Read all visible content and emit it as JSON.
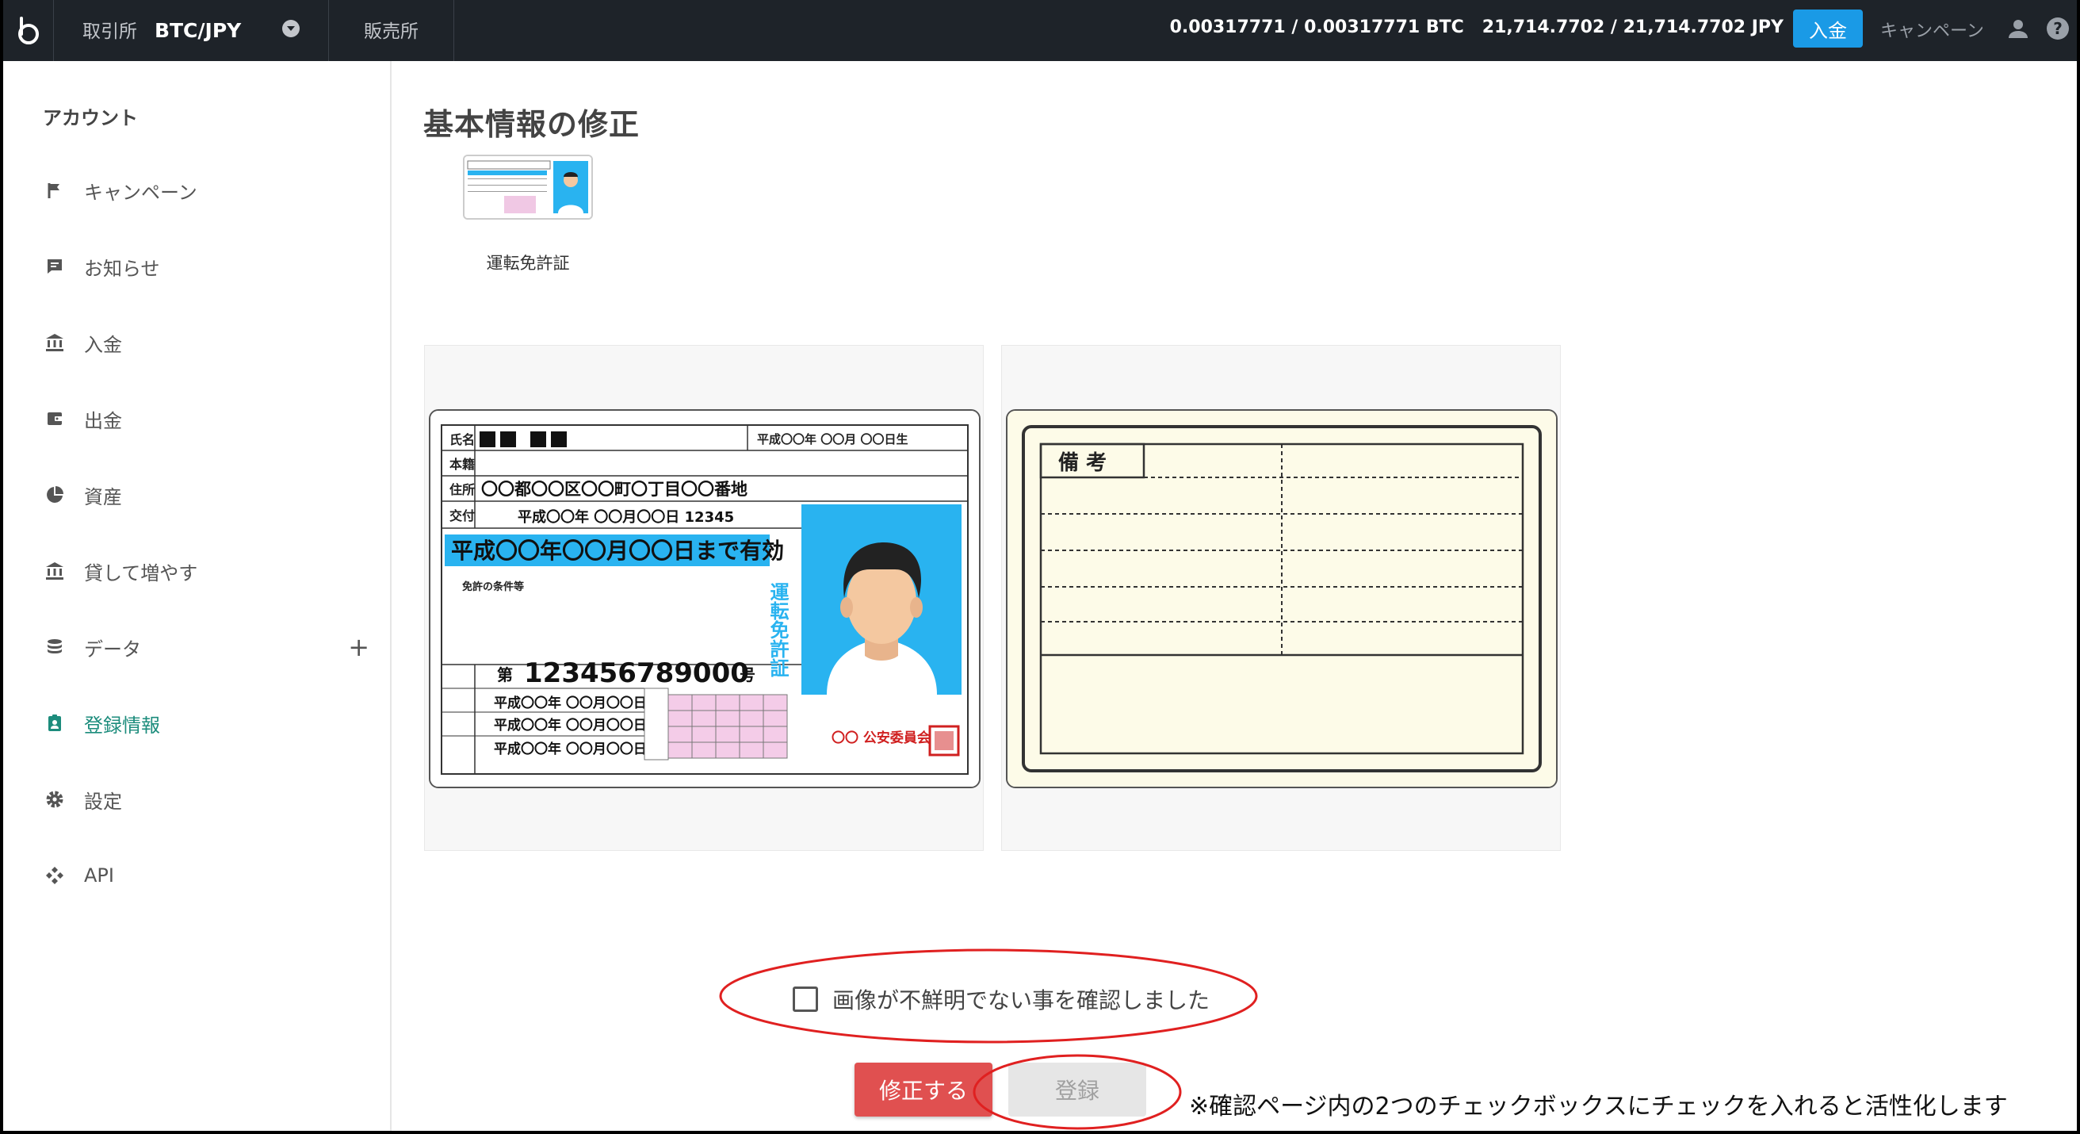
{
  "topbar": {
    "exchange_label": "取引所",
    "pair": "BTC/JPY",
    "sales_label": "販売所",
    "btc_balance": "0.00317771 / 0.00317771 BTC",
    "jpy_balance": "21,714.7702 / 21,714.7702 JPY",
    "deposit_button": "入金",
    "campaign_link": "キャンペーン",
    "icons": [
      "bitbank-logo",
      "chevron-down-icon",
      "user-icon",
      "help-icon"
    ]
  },
  "sidebar": {
    "title": "アカウント",
    "items": [
      {
        "label": "キャンペーン",
        "icon": "flag-icon"
      },
      {
        "label": "お知らせ",
        "icon": "message-icon"
      },
      {
        "label": "入金",
        "icon": "bank-icon"
      },
      {
        "label": "出金",
        "icon": "wallet-icon"
      },
      {
        "label": "資産",
        "icon": "pie-chart-icon"
      },
      {
        "label": "貸して増やす",
        "icon": "bank-icon"
      },
      {
        "label": "データ",
        "icon": "database-icon"
      },
      {
        "label": "登録情報",
        "icon": "id-badge-icon",
        "active": true
      },
      {
        "label": "設定",
        "icon": "gear-icon"
      },
      {
        "label": "API",
        "icon": "api-icon"
      }
    ],
    "active_color": "#1c8c7c"
  },
  "main": {
    "title": "基本情報の修正",
    "doc_type_label": "運転免許証",
    "license_front": {
      "name_label": "氏名",
      "birth": "平成〇〇年 〇〇月 〇〇日生",
      "domicile_label": "本籍",
      "address_label": "住所",
      "address": "〇〇都〇〇区〇〇町〇丁目〇〇番地",
      "issue_label": "交付",
      "issue": "平成〇〇年 〇〇月〇〇日 12345",
      "validity": "平成〇〇年〇〇月〇〇日まで有効",
      "conditions": "免許の条件等",
      "number_prefix": "第",
      "number": "123456789000",
      "number_suffix": "号",
      "vertical_title": "運転免許証",
      "date_row": "平成〇〇年 〇〇月〇〇日",
      "seal_text": "〇〇 公安委員会"
    },
    "license_back": {
      "remarks_label": "備 考"
    },
    "confirm_checkbox_label": "画像が不鮮明でない事を確認しました",
    "fix_button": "修正する",
    "register_button": "登録",
    "note": "※確認ページ内の2つのチェックボックスにチェックを入れると活性化します"
  },
  "colors": {
    "topbar_bg": "#1e2329",
    "deposit_button": "#1a9ae6",
    "fix_button": "#e05050",
    "annotation_red": "#e02020"
  }
}
